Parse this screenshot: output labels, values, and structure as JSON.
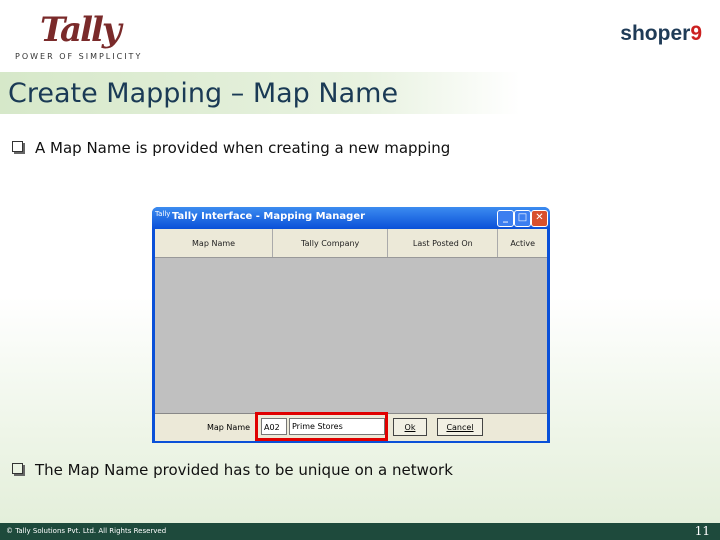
{
  "brand": {
    "tally": "Tally",
    "tagline": "POWER OF SIMPLICITY",
    "shoper": "shoper",
    "shoper_num": "9"
  },
  "slide": {
    "title": "Create Mapping – Map Name",
    "bullet1": {
      "pre": "A ",
      "emph": "Map Name",
      "post": " is provided when creating a new mapping"
    },
    "bullet2": {
      "pre": "The ",
      "emph": "Map Name",
      "post": " provided has to be unique on a network"
    }
  },
  "window": {
    "title": "Tally Interface - Mapping Manager",
    "icon_text": "Tally",
    "columns": [
      "Map Name",
      "Tally Company",
      "Last Posted On",
      "Active"
    ],
    "map_name_label": "Map Name",
    "code_value": "A02",
    "name_value": "Prime Stores",
    "ok_label": "Ok",
    "cancel_label": "Cancel",
    "min_glyph": "_",
    "max_glyph": "□",
    "close_glyph": "✕"
  },
  "footer": {
    "copyright": "© Tally Solutions Pvt. Ltd. All Rights Reserved",
    "page": "11"
  }
}
